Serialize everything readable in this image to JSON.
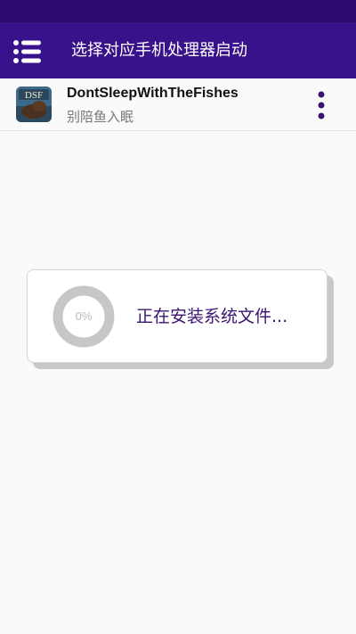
{
  "colors": {
    "status_bar": "#2d0b6e",
    "app_bar": "#37128a",
    "accent": "#3a1470",
    "ring_track": "#c7c7c7"
  },
  "header": {
    "menu_icon": "hamburger-menu-icon",
    "title": "选择对应手机处理器启动"
  },
  "app": {
    "icon_label": "DSF",
    "name": "DontSleepWithTheFishes",
    "subtitle": "别陪鱼入眠",
    "more_icon": "more-vertical-icon"
  },
  "dialog": {
    "progress": 0,
    "progress_text": "0%",
    "message": "正在安装系统文件..."
  }
}
